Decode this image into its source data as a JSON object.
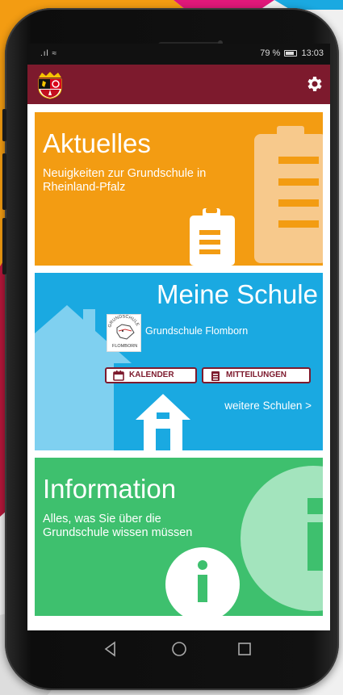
{
  "status_bar": {
    "signal": ".ıl",
    "battery_level": "79 %",
    "time": "13:03"
  },
  "app_bar": {
    "logo": "rlp-coat-of-arms",
    "settings_icon": "gear-icon"
  },
  "cards": {
    "news": {
      "title": "Aktuelles",
      "subtitle": "Neuigkeiten zur Grundschule in Rheinland-Pfalz",
      "icon": "clipboard-icon",
      "color": "#f39c12"
    },
    "school": {
      "title": "Meine Schule",
      "school_logo_text": "GRUNDSCHULE FLOMBORN",
      "school_name": "Grundschule Flomborn",
      "calendar_button": "KALENDER",
      "messages_button": "MITTEILUNGEN",
      "more_link": "weitere Schulen >",
      "icon": "house-icon",
      "color": "#1aa9e1"
    },
    "info": {
      "title": "Information",
      "subtitle": "Alles, was Sie über die Grundschule wissen müssen",
      "icon": "info-icon",
      "color": "#3ec06e"
    }
  },
  "nav_bar": {
    "back": "back-triangle-icon",
    "home": "home-circle-icon",
    "recents": "recents-square-icon"
  },
  "colors": {
    "brand": "#7d1a2d"
  }
}
